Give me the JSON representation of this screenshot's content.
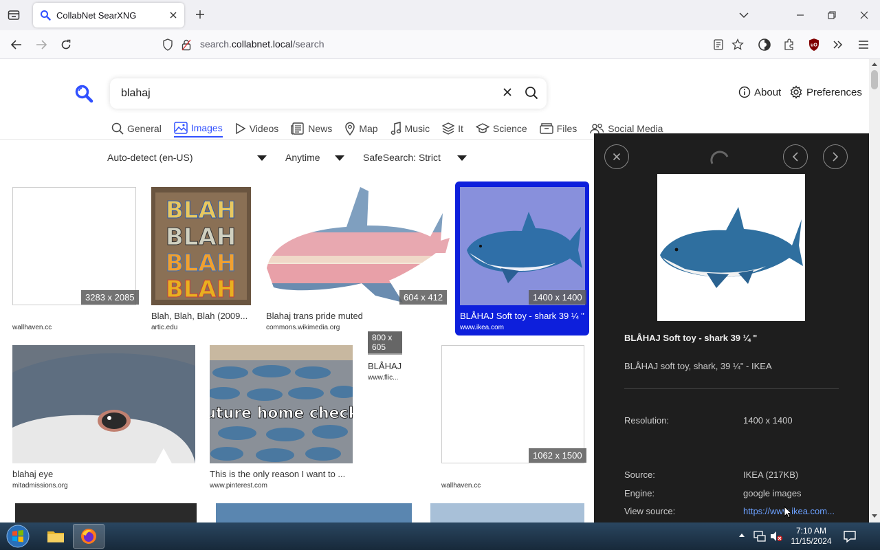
{
  "browser": {
    "tab_title": "CollabNet SearXNG",
    "url_prefix": "search.",
    "url_host": "collabnet.local",
    "url_path": "/search"
  },
  "search": {
    "query": "blahaj"
  },
  "header": {
    "about_label": "About",
    "preferences_label": "Preferences"
  },
  "categories": [
    {
      "label": "General",
      "icon": "search-icon"
    },
    {
      "label": "Images",
      "icon": "image-icon"
    },
    {
      "label": "Videos",
      "icon": "play-icon"
    },
    {
      "label": "News",
      "icon": "newspaper-icon"
    },
    {
      "label": "Map",
      "icon": "map-pin-icon"
    },
    {
      "label": "Music",
      "icon": "music-note-icon"
    },
    {
      "label": "It",
      "icon": "layers-icon"
    },
    {
      "label": "Science",
      "icon": "graduation-cap-icon"
    },
    {
      "label": "Files",
      "icon": "drawer-icon"
    },
    {
      "label": "Social Media",
      "icon": "people-icon"
    }
  ],
  "active_category": "Images",
  "filters": {
    "language": "Auto-detect (en-US)",
    "time": "Anytime",
    "safesearch": "SafeSearch: Strict"
  },
  "results": [
    {
      "resolution": "3283 x 2085",
      "title": "",
      "source": "wallhaven.cc"
    },
    {
      "resolution": "",
      "title": "Blah, Blah, Blah (2009...",
      "source": "artic.edu"
    },
    {
      "resolution": "604 x 412",
      "title": "Blahaj trans pride muted",
      "source": "commons.wikimedia.org"
    },
    {
      "resolution": "1400 x 1400",
      "title": "BLÅHAJ Soft toy - shark 39 ¼ \"",
      "source": "www.ikea.com"
    },
    {
      "resolution": "800 x 605",
      "title": "BLÅHAJ",
      "source": "www.flic...",
      "overlay_text": "BLÅHAJ"
    },
    {
      "resolution": "",
      "title": "blahaj eye",
      "source": "mitadmissions.org"
    },
    {
      "resolution": "",
      "title": "This is the only reason I want to ...",
      "source": "www.pinterest.com",
      "overlay_text": "future home check"
    },
    {
      "resolution": "1062 x 1500",
      "title": "",
      "source": "wallhaven.cc"
    }
  ],
  "detail": {
    "title": "BLÅHAJ Soft toy - shark 39 ¼ \"",
    "description": "BLÅHAJ soft toy, shark, 39 ¼\" - IKEA",
    "resolution_label": "Resolution:",
    "resolution": "1400 x 1400",
    "source_label": "Source:",
    "source": "IKEA (217KB)",
    "engine_label": "Engine:",
    "engine": "google images",
    "view_source_label": "View source:",
    "view_source_url": "https://www.ikea.com..."
  },
  "taskbar": {
    "time": "7:10 AM",
    "date": "11/15/2024"
  },
  "colors": {
    "accent": "#3050ff",
    "selected": "#0d1fdc",
    "detail_bg": "#1e1e1e",
    "shark_blue": "#2f6f9f"
  }
}
